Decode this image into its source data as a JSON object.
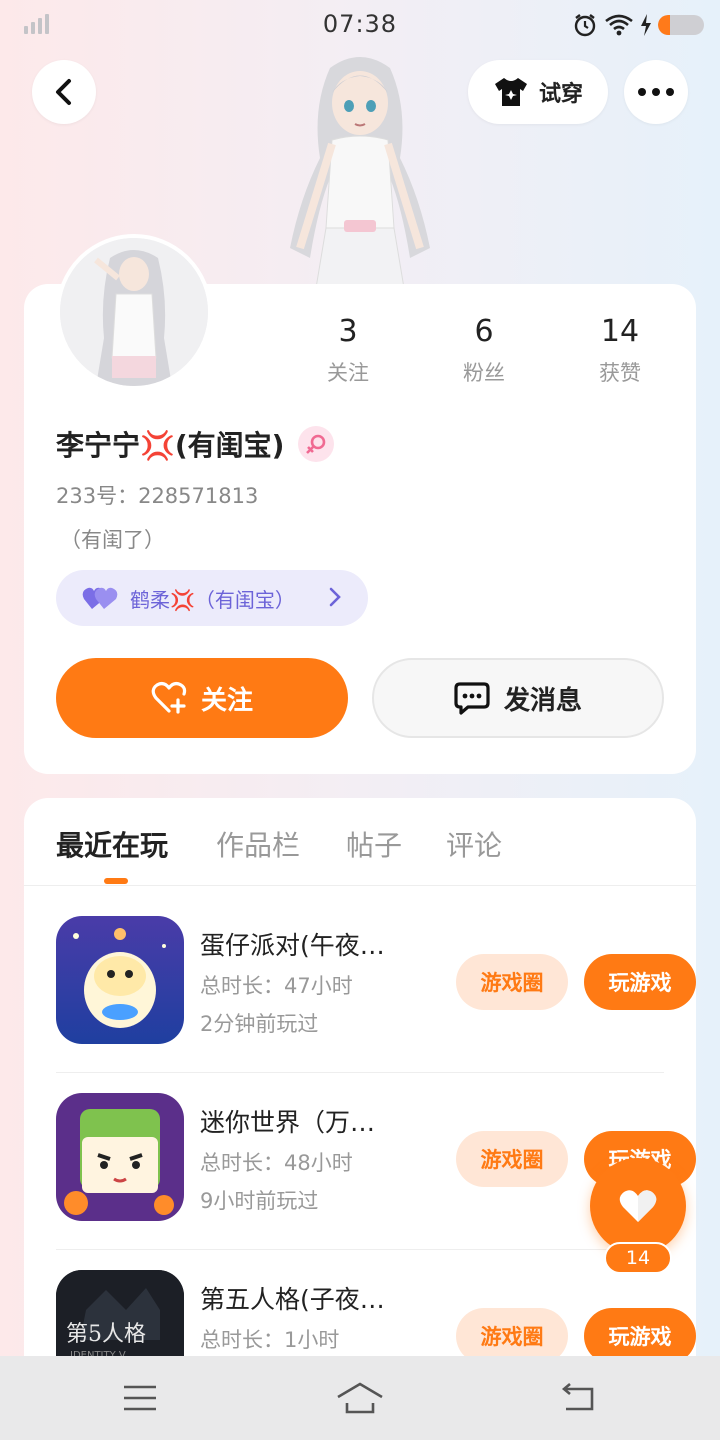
{
  "status_bar": {
    "time": "07:38",
    "icons": [
      "signal-icon",
      "alarm-icon",
      "wifi-icon",
      "charging-icon",
      "battery-icon"
    ],
    "battery_level_fraction": 0.25
  },
  "header": {
    "back_icon": "chevron-left-icon",
    "try_on_label": "试穿",
    "try_on_icon": "tshirt-icon",
    "more_icon": "more-dots-icon"
  },
  "profile": {
    "stats": [
      {
        "value": "3",
        "label": "关注"
      },
      {
        "value": "6",
        "label": "粉丝"
      },
      {
        "value": "14",
        "label": "获赞"
      }
    ],
    "name": "李宁宁💢(有闺宝)",
    "gender_icon": "female-icon",
    "uid": "233号：228571813",
    "bio": "（有闺了）",
    "cp_tag": {
      "icon": "double-heart-icon",
      "label": "鹤柔💢（有闺宝）"
    },
    "follow_label": "关注",
    "message_label": "发消息"
  },
  "tabs": [
    {
      "label": "最近在玩",
      "active": true
    },
    {
      "label": "作品栏",
      "active": false
    },
    {
      "label": "帖子",
      "active": false
    },
    {
      "label": "评论",
      "active": false
    }
  ],
  "games": [
    {
      "title": "蛋仔派对(午夜…",
      "duration": "总时长：47小时",
      "last_played": "2分钟前玩过",
      "circle_label": "游戏圈",
      "play_label": "玩游戏"
    },
    {
      "title": "迷你世界（万…",
      "duration": "总时长：48小时",
      "last_played": "9小时前玩过",
      "circle_label": "游戏圈",
      "play_label": "玩游戏"
    },
    {
      "title": "第五人格(子夜…",
      "duration": "总时长：1小时",
      "last_played": "",
      "circle_label": "游戏圈",
      "play_label": "玩游戏",
      "icon_text": "第5人格",
      "icon_subtext": "IDENTITY V"
    }
  ],
  "like_fab": {
    "count": "14",
    "icon": "heart-icon"
  },
  "nav_bar": {
    "icons": [
      "menu-icon",
      "home-icon",
      "back-icon"
    ]
  },
  "colors": {
    "accent": "#ff7a14",
    "accent_light": "#ffe6d6",
    "cp_bg": "#ecebfb",
    "cp_text": "#6c63d8"
  }
}
